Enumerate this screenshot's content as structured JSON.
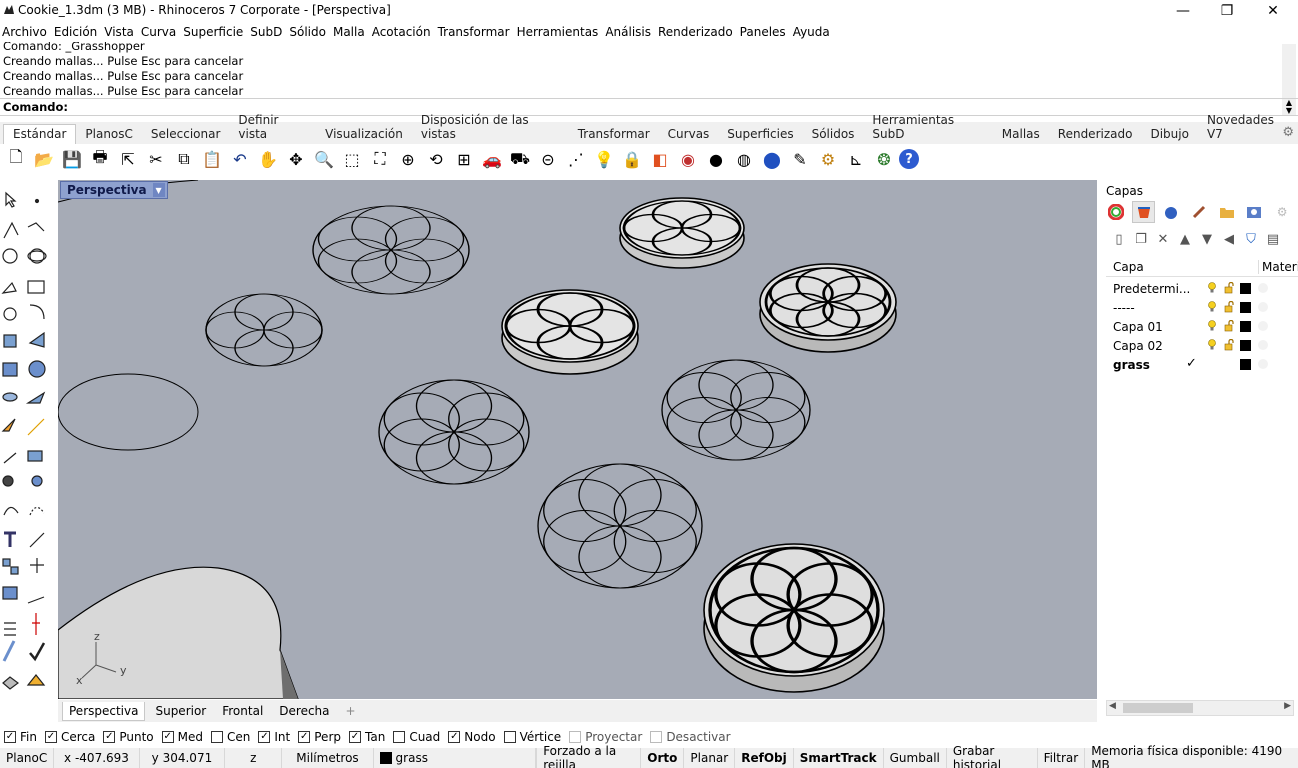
{
  "window": {
    "title": "Cookie_1.3dm (3 MB) - Rhinoceros 7 Corporate - [Perspectiva]",
    "minimize": "—",
    "restore": "❐",
    "close": "✕"
  },
  "menu": [
    "Archivo",
    "Edición",
    "Vista",
    "Curva",
    "Superficie",
    "SubD",
    "Sólido",
    "Malla",
    "Acotación",
    "Transformar",
    "Herramientas",
    "Análisis",
    "Renderizado",
    "Paneles",
    "Ayuda"
  ],
  "command": {
    "history": [
      "Comando: _Grasshopper",
      "Creando mallas... Pulse Esc para cancelar",
      "Creando mallas... Pulse Esc para cancelar",
      "Creando mallas... Pulse Esc para cancelar"
    ],
    "prompt": "Comando:",
    "value": ""
  },
  "toolbar_tabs": [
    "Estándar",
    "PlanosC",
    "Seleccionar",
    "Definir vista",
    "Visualización",
    "Disposición de las vistas",
    "Transformar",
    "Curvas",
    "Superficies",
    "Sólidos",
    "Herramientas SubD",
    "Mallas",
    "Renderizado",
    "Dibujo",
    "Novedades V7"
  ],
  "active_toolbar_tab": "Estándar",
  "toolbar_icons": [
    "new-icon",
    "open-icon",
    "save-icon",
    "print-icon",
    "import-icon",
    "cut-icon",
    "copy-icon",
    "paste-icon",
    "undo-icon",
    "pan-hand-icon",
    "rotate-view-icon",
    "zoom-icon",
    "zoom-window-icon",
    "zoom-extents-icon",
    "zoom-selected-icon",
    "undo-view-icon",
    "viewport-layout-icon",
    "car-render-icon",
    "shaded-car-icon",
    "construction-plane-icon",
    "osnap-icon",
    "light-bulb-icon",
    "lock-icon",
    "layer-icon",
    "color-wheel-icon",
    "material-sphere-icon",
    "rendered-sphere-icon",
    "blue-sphere-icon",
    "render-tools-icon",
    "options-gear-icon",
    "dimension-icon",
    "grasshopper-icon",
    "help-icon"
  ],
  "viewport": {
    "name": "Perspectiva",
    "axes": {
      "z": "z",
      "y": "y",
      "x": "x"
    }
  },
  "view_tabs": [
    "Perspectiva",
    "Superior",
    "Frontal",
    "Derecha"
  ],
  "active_view_tab": "Perspectiva",
  "add_view": "+",
  "panel": {
    "title": "Capas",
    "column_layer": "Capa",
    "column_material": "Materi",
    "layers": [
      {
        "name": "Predetermi...",
        "current": false,
        "bold": false
      },
      {
        "name": "-----",
        "current": false,
        "bold": false
      },
      {
        "name": "Capa 01",
        "current": false,
        "bold": false
      },
      {
        "name": "Capa 02",
        "current": false,
        "bold": false
      },
      {
        "name": "grass",
        "current": true,
        "bold": true
      }
    ]
  },
  "osnaps": [
    {
      "label": "Fin",
      "checked": true,
      "enabled": true
    },
    {
      "label": "Cerca",
      "checked": true,
      "enabled": true
    },
    {
      "label": "Punto",
      "checked": true,
      "enabled": true
    },
    {
      "label": "Med",
      "checked": true,
      "enabled": true
    },
    {
      "label": "Cen",
      "checked": false,
      "enabled": true
    },
    {
      "label": "Int",
      "checked": true,
      "enabled": true
    },
    {
      "label": "Perp",
      "checked": true,
      "enabled": true
    },
    {
      "label": "Tan",
      "checked": true,
      "enabled": true
    },
    {
      "label": "Cuad",
      "checked": false,
      "enabled": true
    },
    {
      "label": "Nodo",
      "checked": true,
      "enabled": true
    },
    {
      "label": "Vértice",
      "checked": false,
      "enabled": true
    },
    {
      "label": "Proyectar",
      "checked": false,
      "enabled": false
    },
    {
      "label": "Desactivar",
      "checked": false,
      "enabled": false
    }
  ],
  "status": {
    "cplane": "PlanoC",
    "x": "x -407.693",
    "y": "y 304.071",
    "z": "z",
    "units": "Milímetros",
    "layer": "grass",
    "buttons": [
      {
        "label": "Forzado a la rejilla",
        "bold": false
      },
      {
        "label": "Orto",
        "bold": true
      },
      {
        "label": "Planar",
        "bold": false
      },
      {
        "label": "RefObj",
        "bold": true
      },
      {
        "label": "SmartTrack",
        "bold": true
      },
      {
        "label": "Gumball",
        "bold": false
      },
      {
        "label": "Grabar historial",
        "bold": false
      },
      {
        "label": "Filtrar",
        "bold": false
      }
    ],
    "memory": "Memoria física disponible: 4190 MB"
  },
  "colors": {
    "viewport_bg": "#a6abb6",
    "viewport_tab": "#8ea1cf",
    "panel_bg": "#ffffff",
    "layer_color": "#000000"
  }
}
